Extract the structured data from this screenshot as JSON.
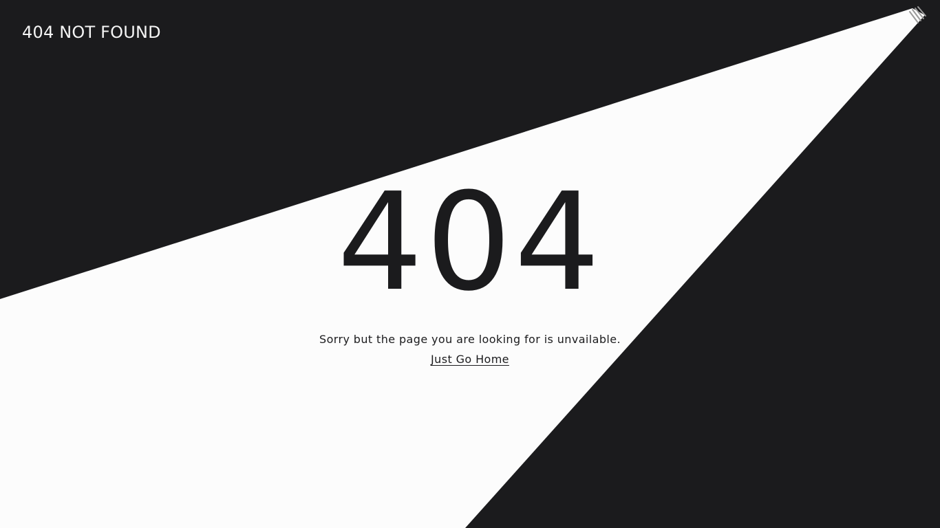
{
  "header": {
    "site_title": "404 NOT FOUND"
  },
  "main": {
    "error_code": "404",
    "message": "Sorry but the page you are looking for is unvailable.",
    "home_link_label": "Just Go Home"
  },
  "theme": {
    "background": "#1b1b1d",
    "spotlight": "#fcfcfc",
    "text_on_dark": "#f5f5f5",
    "text_on_light": "#1b1b1d",
    "lamp_stripes": "#9a9a9a"
  },
  "icons": {
    "lamp": "spotlight-lamp-icon"
  }
}
